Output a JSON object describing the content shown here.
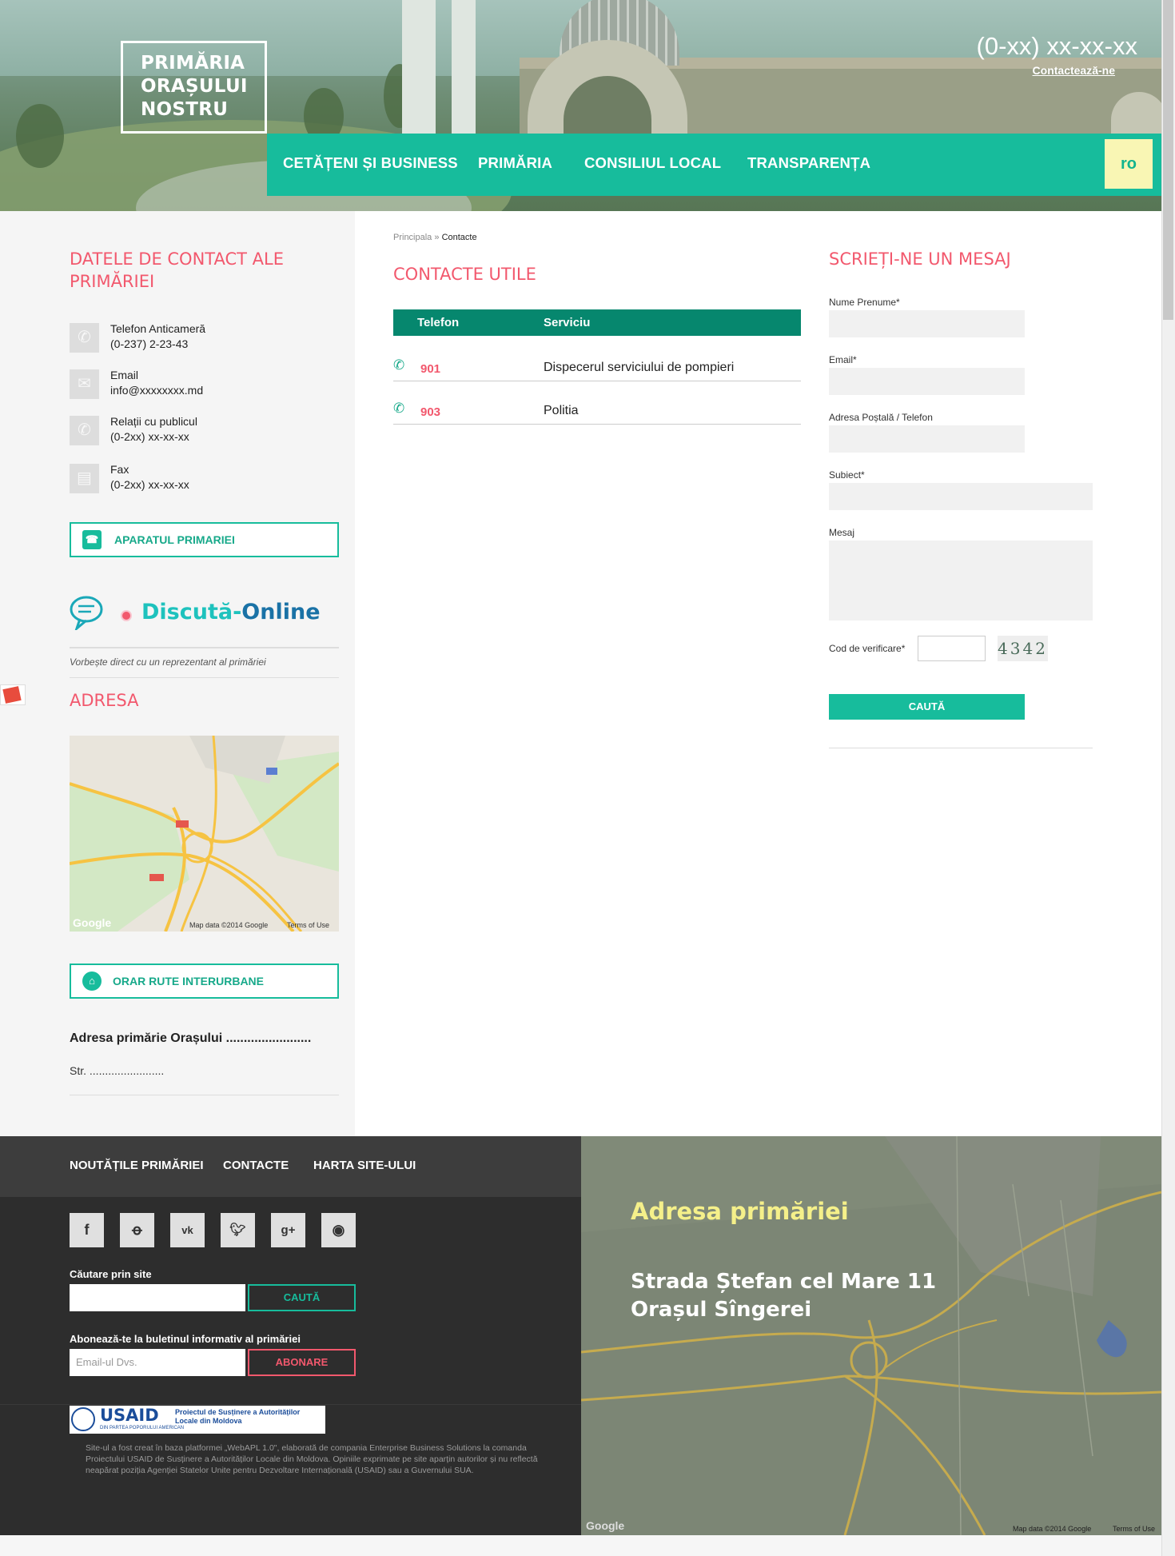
{
  "header": {
    "logo_lines": [
      "PRIMĂRIA",
      "ORAȘULUI",
      "NOSTRU"
    ],
    "phone": "(0-xx) xx-xx-xx",
    "contact_link": "Contactează-ne",
    "lang": "ro",
    "nav": [
      "CETĂȚENI ȘI BUSINESS",
      "PRIMĂRIA",
      "CONSILIUL LOCAL",
      "TRANSPARENȚA"
    ]
  },
  "left": {
    "title": "DATELE DE CONTACT ALE PRIMĂRIEI",
    "contacts": [
      {
        "icon": "phone-icon",
        "label": "Telefon Anticameră",
        "value": "(0-237) 2-23-43"
      },
      {
        "icon": "mail-icon",
        "label": "Email",
        "value": "info@xxxxxxxx.md"
      },
      {
        "icon": "phone-icon",
        "label": "Relații cu publicul",
        "value": "(0-2xx) xx-xx-xx"
      },
      {
        "icon": "fax-icon",
        "label": "Fax",
        "value": "(0-2xx) xx-xx-xx"
      }
    ],
    "aparatul_btn": "APARATUL PRIMARIEI",
    "online_part1": "Discută-",
    "online_part2": "Online",
    "online_sub": "Vorbește direct cu un reprezentant al primăriei",
    "adresa_title": "ADRESA",
    "map_credit": "Map data ©2014 Google",
    "map_terms": "Terms of Use",
    "map_logo": "Google",
    "orar_btn": "ORAR RUTE INTERURBANE",
    "addr_title": "Adresa primărie Orașului ........................",
    "addr_street": "Str. ........................"
  },
  "center": {
    "breadcrumb_home": "Principala",
    "breadcrumb_sep": "»",
    "breadcrumb_current": "Contacte",
    "title": "CONTACTE UTILE",
    "table_headers": [
      "Telefon",
      "Serviciu"
    ],
    "rows": [
      {
        "num": "901",
        "service": "Dispecerul serviciului de pompieri"
      },
      {
        "num": "903",
        "service": "Politia"
      }
    ]
  },
  "form": {
    "title": "SCRIEȚI-NE UN MESAJ",
    "labels": [
      "Nume Prenume*",
      "Email*",
      "Adresa Poștală / Telefon",
      "Subiect*",
      "Mesaj"
    ],
    "captcha_label": "Cod de verificare*",
    "captcha_text": "4342",
    "submit": "CAUTĂ"
  },
  "footer": {
    "nav": [
      "NOUTĂȚILE PRIMĂRIEI",
      "CONTACTE",
      "HARTA SITE-ULUI"
    ],
    "social": [
      "f",
      "ok",
      "vk",
      "tw",
      "g+",
      "rss"
    ],
    "search_label": "Căutare prin site",
    "search_btn": "CAUTĂ",
    "newsletter_label": "Abonează-te la buletinul informativ al primăriei",
    "newsletter_placeholder": "Email-ul Dvs.",
    "newsletter_btn": "ABONARE",
    "usaid_logo": "USAID",
    "usaid_sub": "DIN PARTEA POPORULUI AMERICAN",
    "usaid_project": "Proiectul de Susținere a Autorităților Locale din Moldova",
    "disclaimer": "Site-ul a fost creat în baza platformei „WebAPL 1.0\", elaborată de compania Enterprise Business Solutions la comanda Proiectului USAID de Susținere a Autorităților Locale din Moldova. Opiniile exprimate pe site aparțin autorilor și nu reflectă neapărat poziția Agenției Statelor Unite pentru Dezvoltare Internațională (USAID) sau a Guvernului SUA.",
    "addr_title": "Adresa primăriei",
    "addr_line1": "Strada Ștefan cel Mare 11",
    "addr_line2": "Orașul Sîngerei",
    "map_credit": "Map data ©2014 Google",
    "map_terms": "Terms of Use",
    "map_logo": "Google"
  },
  "colors": {
    "accent": "#17bc9c",
    "accent_dark": "#06876e",
    "pink": "#f2586d",
    "yellow": "#f5f08a"
  }
}
